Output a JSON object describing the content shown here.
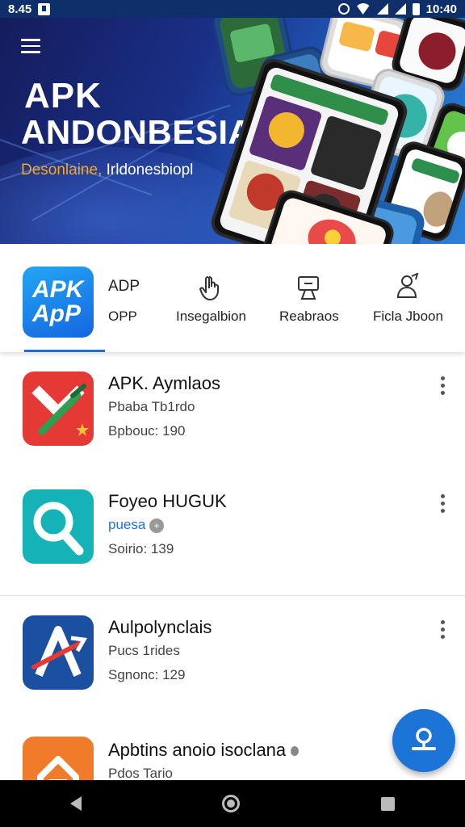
{
  "status_bar": {
    "time_left": "8.45",
    "time_right": "10:40"
  },
  "banner": {
    "title_line1": "APK",
    "title_line2": "ANDONBESIA",
    "tagline_highlight": "Desonlaine,",
    "tagline_rest": " Irldonesbiopl"
  },
  "categories": {
    "logo_line1": "APK",
    "logo_line2": "ApP",
    "app_label_top": "ADP",
    "app_label_bottom": "OPP",
    "items": [
      {
        "label": "Insegalbion",
        "icon": "hand-pointer-icon"
      },
      {
        "label": "Reabraos",
        "icon": "display-stand-icon"
      },
      {
        "label": "Ficla Jboon",
        "icon": "user-edit-icon"
      }
    ]
  },
  "apps": [
    {
      "name": "APK. Aymlaos",
      "sub": "Pbaba Tb1rdo",
      "meta": "Bpbouc: 190",
      "icon": "apk-star-icon",
      "color": "#e53935"
    },
    {
      "name": "Foyeo HUGUK",
      "sub": "puesa",
      "meta": "Soirio: 139",
      "icon": "magnifier-icon",
      "color": "#15b3b8",
      "sub_color": "#1a73e8"
    },
    {
      "name": "Aulpolynclais",
      "sub": "Pucs 1rides",
      "meta": "Sgnonc: 129",
      "icon": "a-arrow-icon",
      "color": "#1b4fa0"
    },
    {
      "name": "Apbtins anoio isoclana",
      "sub": "Pdos Tario",
      "meta": "",
      "icon": "house-orange-icon",
      "color": "#f07b2a"
    }
  ],
  "fab": {
    "icon": "user-icon"
  }
}
